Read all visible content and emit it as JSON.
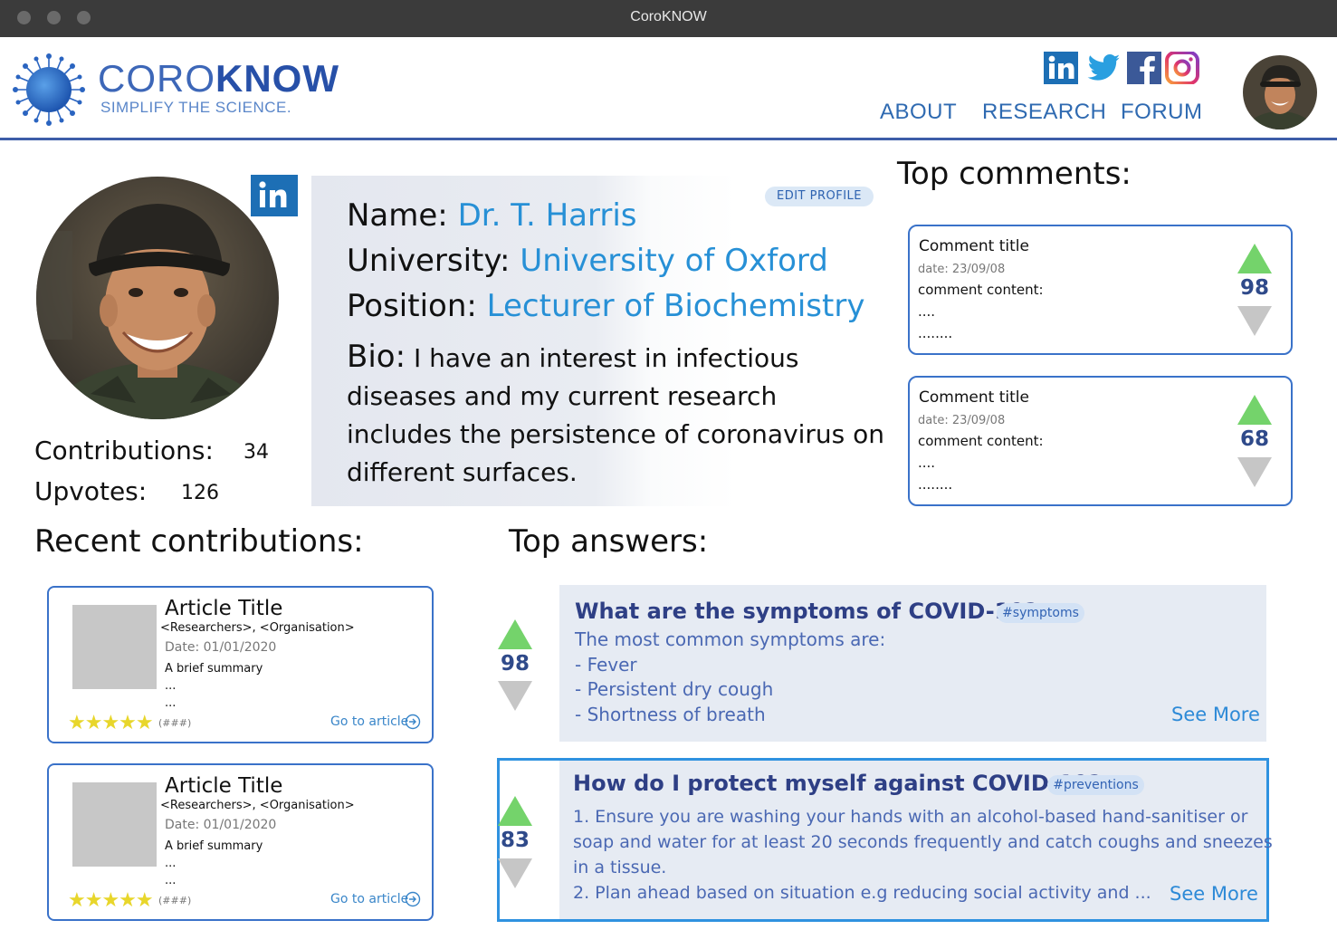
{
  "window": {
    "title": "CoroKNOW"
  },
  "brand": {
    "name_light": "CORO",
    "name_bold": "KNOW",
    "tagline": "SIMPLIFY THE SCIENCE.",
    "primary_color": "#2750a8",
    "accent_color": "#2790d6"
  },
  "socials": [
    {
      "icon": "linkedin-icon",
      "color": "#1d6fb5"
    },
    {
      "icon": "twitter-icon",
      "color": "#2a9fe0"
    },
    {
      "icon": "facebook-icon",
      "color": "#3b5998"
    },
    {
      "icon": "instagram-icon",
      "color": "#d6336c"
    }
  ],
  "nav": {
    "about": "ABOUT",
    "research": "RESEARCH",
    "forum": "FORUM"
  },
  "profile": {
    "edit_label": "EDIT PROFILE",
    "name_label": "Name: ",
    "name": "Dr. T. Harris",
    "university_label": "University: ",
    "university": "University of Oxford",
    "position_label": "Position: ",
    "position": "Lecturer of Biochemistry",
    "bio_label": "Bio:",
    "bio": "I have an interest in infectious diseases and my current research includes the persistence of coronavirus on different surfaces.",
    "contributions_label": "Contributions:",
    "contributions": "34",
    "upvotes_label": "Upvotes:",
    "upvotes": "126"
  },
  "top_comments": {
    "heading": "Top comments:",
    "items": [
      {
        "title": "Comment title",
        "date": "date: 23/09/08",
        "content": "comment content:",
        "line2": "....",
        "line3": "........",
        "votes": "98"
      },
      {
        "title": "Comment title",
        "date": "date: 23/09/08",
        "content": "comment content:",
        "line2": "....",
        "line3": "........",
        "votes": "68"
      }
    ]
  },
  "recent": {
    "heading": "Recent contributions:",
    "items": [
      {
        "title": "Article Title",
        "researchers": "<Researchers>, <Organisation>",
        "date": "Date: 01/01/2020",
        "summary": "A brief summary",
        "dots1": "...",
        "dots2": "...",
        "stars": "★★★★★",
        "rating_count": "(###)",
        "link": "Go to article"
      },
      {
        "title": "Article Title",
        "researchers": "<Researchers>, <Organisation>",
        "date": "Date: 01/01/2020",
        "summary": "A brief summary",
        "dots1": "...",
        "dots2": "...",
        "stars": "★★★★★",
        "rating_count": "(###)",
        "link": "Go to article"
      }
    ]
  },
  "top_answers": {
    "heading": "Top answers:",
    "items": [
      {
        "question": "What are the symptoms of COVID-19?",
        "tag": "#symptoms",
        "votes": "98",
        "lines": [
          "The most common symptoms are:",
          "- Fever",
          "- Persistent dry cough",
          "- Shortness of breath"
        ],
        "see_more": "See More"
      },
      {
        "question": "How do I protect myself against COVID-19?",
        "tag": "#preventions",
        "votes": "83",
        "lines": [
          "1. Ensure you are washing your hands with an alcohol-based hand-sanitiser or",
          "soap and water for at least 20 seconds frequently and catch coughs and sneezes",
          "in a tissue.",
          "2. Plan ahead based on situation e.g reducing social activity and ..."
        ],
        "see_more": "See More"
      }
    ]
  }
}
